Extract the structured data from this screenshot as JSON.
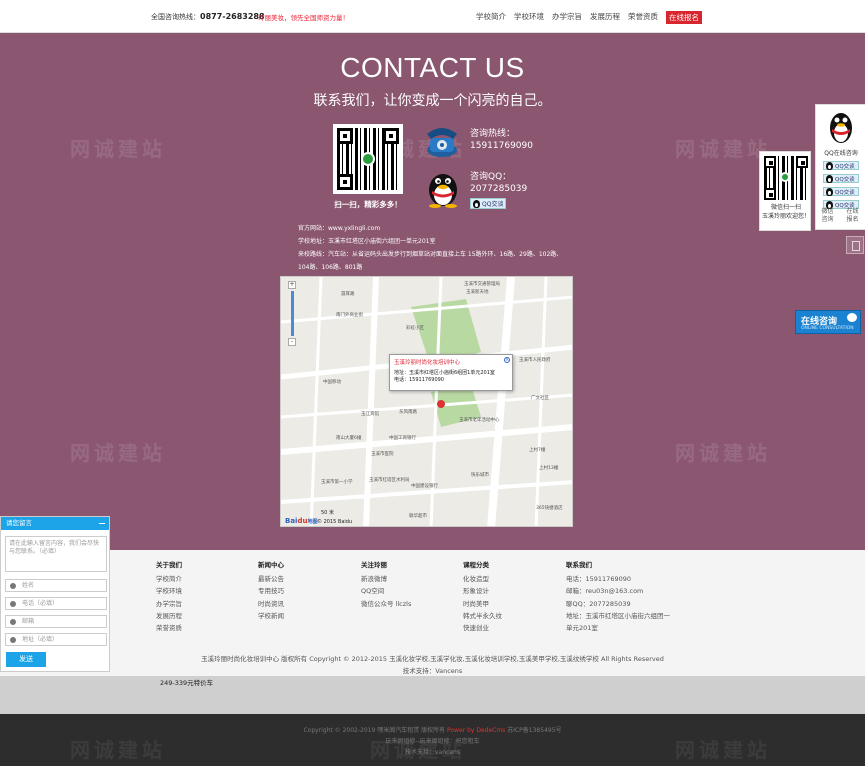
{
  "topbar": {
    "hotline_label": "全国咨询热线：",
    "hotline_number": "0877-2683288",
    "slogan": "玲丽美妆，领先全国师资力量！",
    "nav": [
      "学校简介",
      "学校环境",
      "办学宗旨",
      "发展历程",
      "荣誉资质"
    ],
    "signup": "在线报名"
  },
  "contact": {
    "title": "CONTACT US",
    "subtitle": "联系我们，让你变成一个闪亮的自己。",
    "qr_caption": "扫一扫，精彩多多！",
    "phone_label": "咨询热线：",
    "phone_number": "15911769090",
    "qq_label": "咨询QQ：",
    "qq_number": "2077285039",
    "qq_button": "QQ交谈",
    "website": "官方网站：www.yxlingli.com",
    "address": "学校地址：玉溪市红塔区小庙街六组团一单元201室",
    "route1": "来校路线：汽车站：从省运码头出发步行到烟草站对面直接上车 15路外环、16路、29路、102路、",
    "route2": "104路、106路、801路"
  },
  "map": {
    "popup_title": "玉溪玲丽时尚化妆培训中心",
    "popup_address": "地址：玉溪市红塔区小庙街6组团1单元201室",
    "popup_phone": "电话：15911769090",
    "scale": "50 米",
    "copyright": "© 2015 Baidu",
    "logo_a": "Bai",
    "logo_b": "du",
    "logo_c": "地图",
    "zoom_in": "+",
    "zoom_out": "-",
    "close": "×",
    "labels": {
      "l1": "玉溪市交通管理局",
      "l2": "玉溪新天地",
      "l3": "南门外商业街",
      "l4": "聂耳路",
      "l5": "玉溪市人民政府",
      "l6": "中国移动",
      "l7": "玉江宾馆",
      "l8": "南山大厦6幢",
      "l9": "中国建设银行",
      "l10": "玉溪市红塔区水利局",
      "l11": "上村7幢",
      "l12": "上村13幢",
      "l13": "广文社区",
      "l14": "快乐城市",
      "l15": "365快捷酒店",
      "l16": "联华超市",
      "l17": "彩虹小区",
      "l18": "玉溪市第一小学",
      "l19": "玉溪市老年活动中心",
      "l20": "东风南路",
      "l21": "中国工商银行",
      "l22": "玉溪市医院"
    }
  },
  "qrpanel": {
    "line1": "微信扫一扫",
    "line2": "玉溪玲丽欢迎您！"
  },
  "sidebar": {
    "title": "QQ在线咨询",
    "buttons": [
      "QQ交谈",
      "QQ交谈",
      "QQ交谈",
      "QQ交谈"
    ],
    "wechat": "微信\n咨询",
    "online_reg": "在线\n报名"
  },
  "online": {
    "title": "在线咨询",
    "sub": "ONLINE CONSULTATION"
  },
  "msgform": {
    "title": "请您留言",
    "content_placeholder": "请在此输入留言内容，我们会尽快与您联系。（必填）",
    "fields": [
      "姓名",
      "电话（必填）",
      "邮箱",
      "地址（必填）"
    ],
    "send": "发送"
  },
  "footer": {
    "cols": [
      {
        "head": "关于我们",
        "items": [
          "学校简介",
          "学校环境",
          "办学宗旨",
          "发展历程",
          "荣誉资质"
        ]
      },
      {
        "head": "新闻中心",
        "items": [
          "最新公告",
          "专用技巧",
          "时尚资讯",
          "学校新闻"
        ]
      },
      {
        "head": "关注玲丽",
        "items": [
          "新浪微博",
          "QQ空间",
          "微信公众号 llczls"
        ]
      },
      {
        "head": "课程分类",
        "items": [
          "化妆造型",
          "形象设计",
          "时尚美甲",
          "韩式半永久纹",
          "快速创业"
        ]
      },
      {
        "head": "联系我们",
        "items": [
          "电话：15911769090",
          "邮箱：reu03n@163.com",
          "聊QQ：2077285039",
          "地址：玉溪市红塔区小庙街六组团一",
          "单元201室"
        ]
      }
    ],
    "copyright": "玉溪玲丽时尚化妆培训中心 版权所有 Copyright © 2012-2015 玉溪化妆学校,玉溪学化妆,玉溪化妆培训学校,玉溪美甲学校,玉溪纹绣学校 All Rights Reserved",
    "support": "技术支持：Vancens"
  },
  "car_text": "249-339元特价车",
  "bottom": {
    "line1_a": "Copyright © 2002-2019 嘿米阁汽车租赁 版权所有 ",
    "line1_b": "Power by DedeCms",
    "line1_c": " 苏ICP备1385495号",
    "line2": "玩来阁组修--玩来阁组修：祝您租车",
    "line3": "技术支持：vancens"
  },
  "watermark": "网诚建站",
  "colors": {
    "purple": "#8a5670",
    "accent_blue": "#1da3e8",
    "signup_red": "#d9262e"
  }
}
